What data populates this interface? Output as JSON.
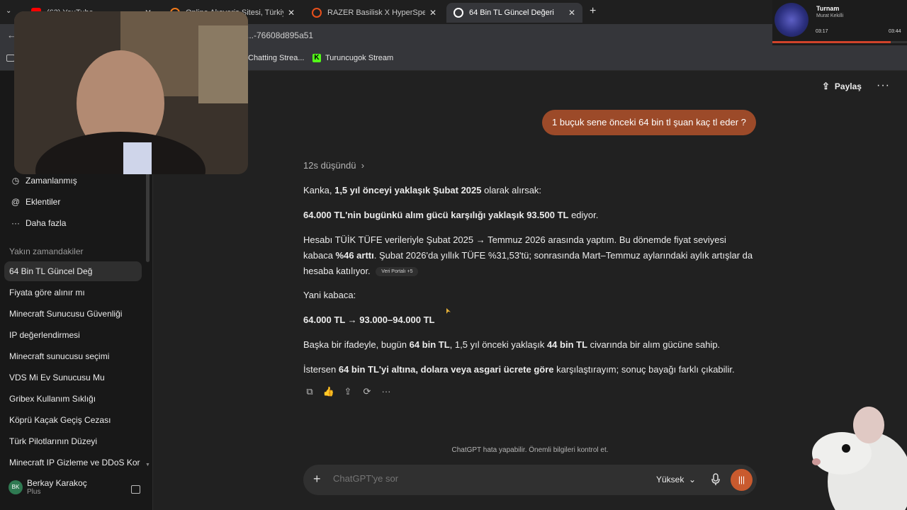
{
  "browser": {
    "tabs": [
      {
        "title": "(63) YouTube",
        "favicon_color": "#ff0000"
      },
      {
        "title": "Online Alışveriş Sitesi, Türkiye'nin...",
        "favicon_color": "#f27a1a"
      },
      {
        "title": "RAZER Basilisk X HyperSpeed 1...",
        "favicon_color": "#e8501c"
      },
      {
        "title": "64 Bin TL Güncel Değeri",
        "favicon_color": "#ffffff",
        "active": true
      }
    ],
    "url": "...-76608d895a51",
    "bookmarks": [
      {
        "label": "Chatting Strea..."
      },
      {
        "label": "Turuncugok Stream",
        "icon": "kick-icon"
      }
    ]
  },
  "sidebar": {
    "nav": [
      {
        "label": "Zamanlanmış",
        "icon": "clock-icon"
      },
      {
        "label": "Eklentiler",
        "icon": "at-icon"
      },
      {
        "label": "Daha fazla",
        "icon": "dots-icon"
      }
    ],
    "recent_title": "Yakın zamandakiler",
    "chats": [
      {
        "label": "64 Bin TL Güncel Değ",
        "active": true
      },
      {
        "label": "Fiyata göre alınır mı"
      },
      {
        "label": "Minecraft Sunucusu Güvenliği"
      },
      {
        "label": "IP değerlendirmesi"
      },
      {
        "label": "Minecraft sunucusu seçimi"
      },
      {
        "label": "VDS Mi Ev Sunucusu Mu"
      },
      {
        "label": "Gribex Kullanım Sıklığı"
      },
      {
        "label": "Köprü Kaçak Geçiş Cezası"
      },
      {
        "label": "Türk Pilotlarının Düzeyi"
      },
      {
        "label": "Minecraft IP Gizleme ve DDoS Kor"
      }
    ],
    "user": {
      "initials": "BK",
      "name": "Berkay Karakoç",
      "plan": "Plus"
    }
  },
  "header": {
    "share_label": "Paylaş",
    "more_label": "···"
  },
  "conversation": {
    "user_message": "1 buçuk sene önceki 64 bin tl şuan kaç tl eder ?",
    "thought_label": "12s düşündü",
    "p1_a": "Kanka, ",
    "p1_b": "1,5 yıl önceyi yaklaşık Şubat 2025",
    "p1_c": " olarak alırsak:",
    "p2_a": "64.000 TL'nin bugünkü alım gücü karşılığı yaklaşık 93.500 TL",
    "p2_b": " ediyor.",
    "p3_a": "Hesabı TÜİK TÜFE verileriyle Şubat 2025 → Temmuz 2026 arasında yaptım. Bu dönemde fiyat seviyesi kabaca ",
    "p3_b": "%46 arttı",
    "p3_c": ". Şubat 2026'da yıllık TÜFE %31,53'tü; sonrasında Mart–Temmuz aylarındaki aylık artışlar da hesaba katılıyor.",
    "source_chip": "Veri Portalı +5",
    "p4": "Yani kabaca:",
    "p5": "64.000 TL → 93.000–94.000 TL",
    "p6_a": "Başka bir ifadeyle, bugün ",
    "p6_b": "64 bin TL",
    "p6_c": ", 1,5 yıl önceki yaklaşık ",
    "p6_d": "44 bin TL",
    "p6_e": " civarında bir alım gücüne sahip.",
    "p7_a": "İstersen ",
    "p7_b": "64 bin TL'yi altına, dolara veya asgari ücrete göre",
    "p7_c": " karşılaştırayım; sonuç bayağı farklı çıkabilir."
  },
  "disclaimer": "ChatGPT hata yapabilir. Önemli bilgileri kontrol et.",
  "composer": {
    "placeholder": "ChatGPT'ye sor",
    "model": "Yüksek"
  },
  "music_player": {
    "title": "Turnam",
    "artist": "Murat Kekilli",
    "elapsed": "03:17",
    "total": "03:44",
    "progress": 0.88
  },
  "colors": {
    "accent": "#c95a2e",
    "user_bubble": "#9c4a29",
    "background": "#212121",
    "sidebar": "#181818"
  }
}
